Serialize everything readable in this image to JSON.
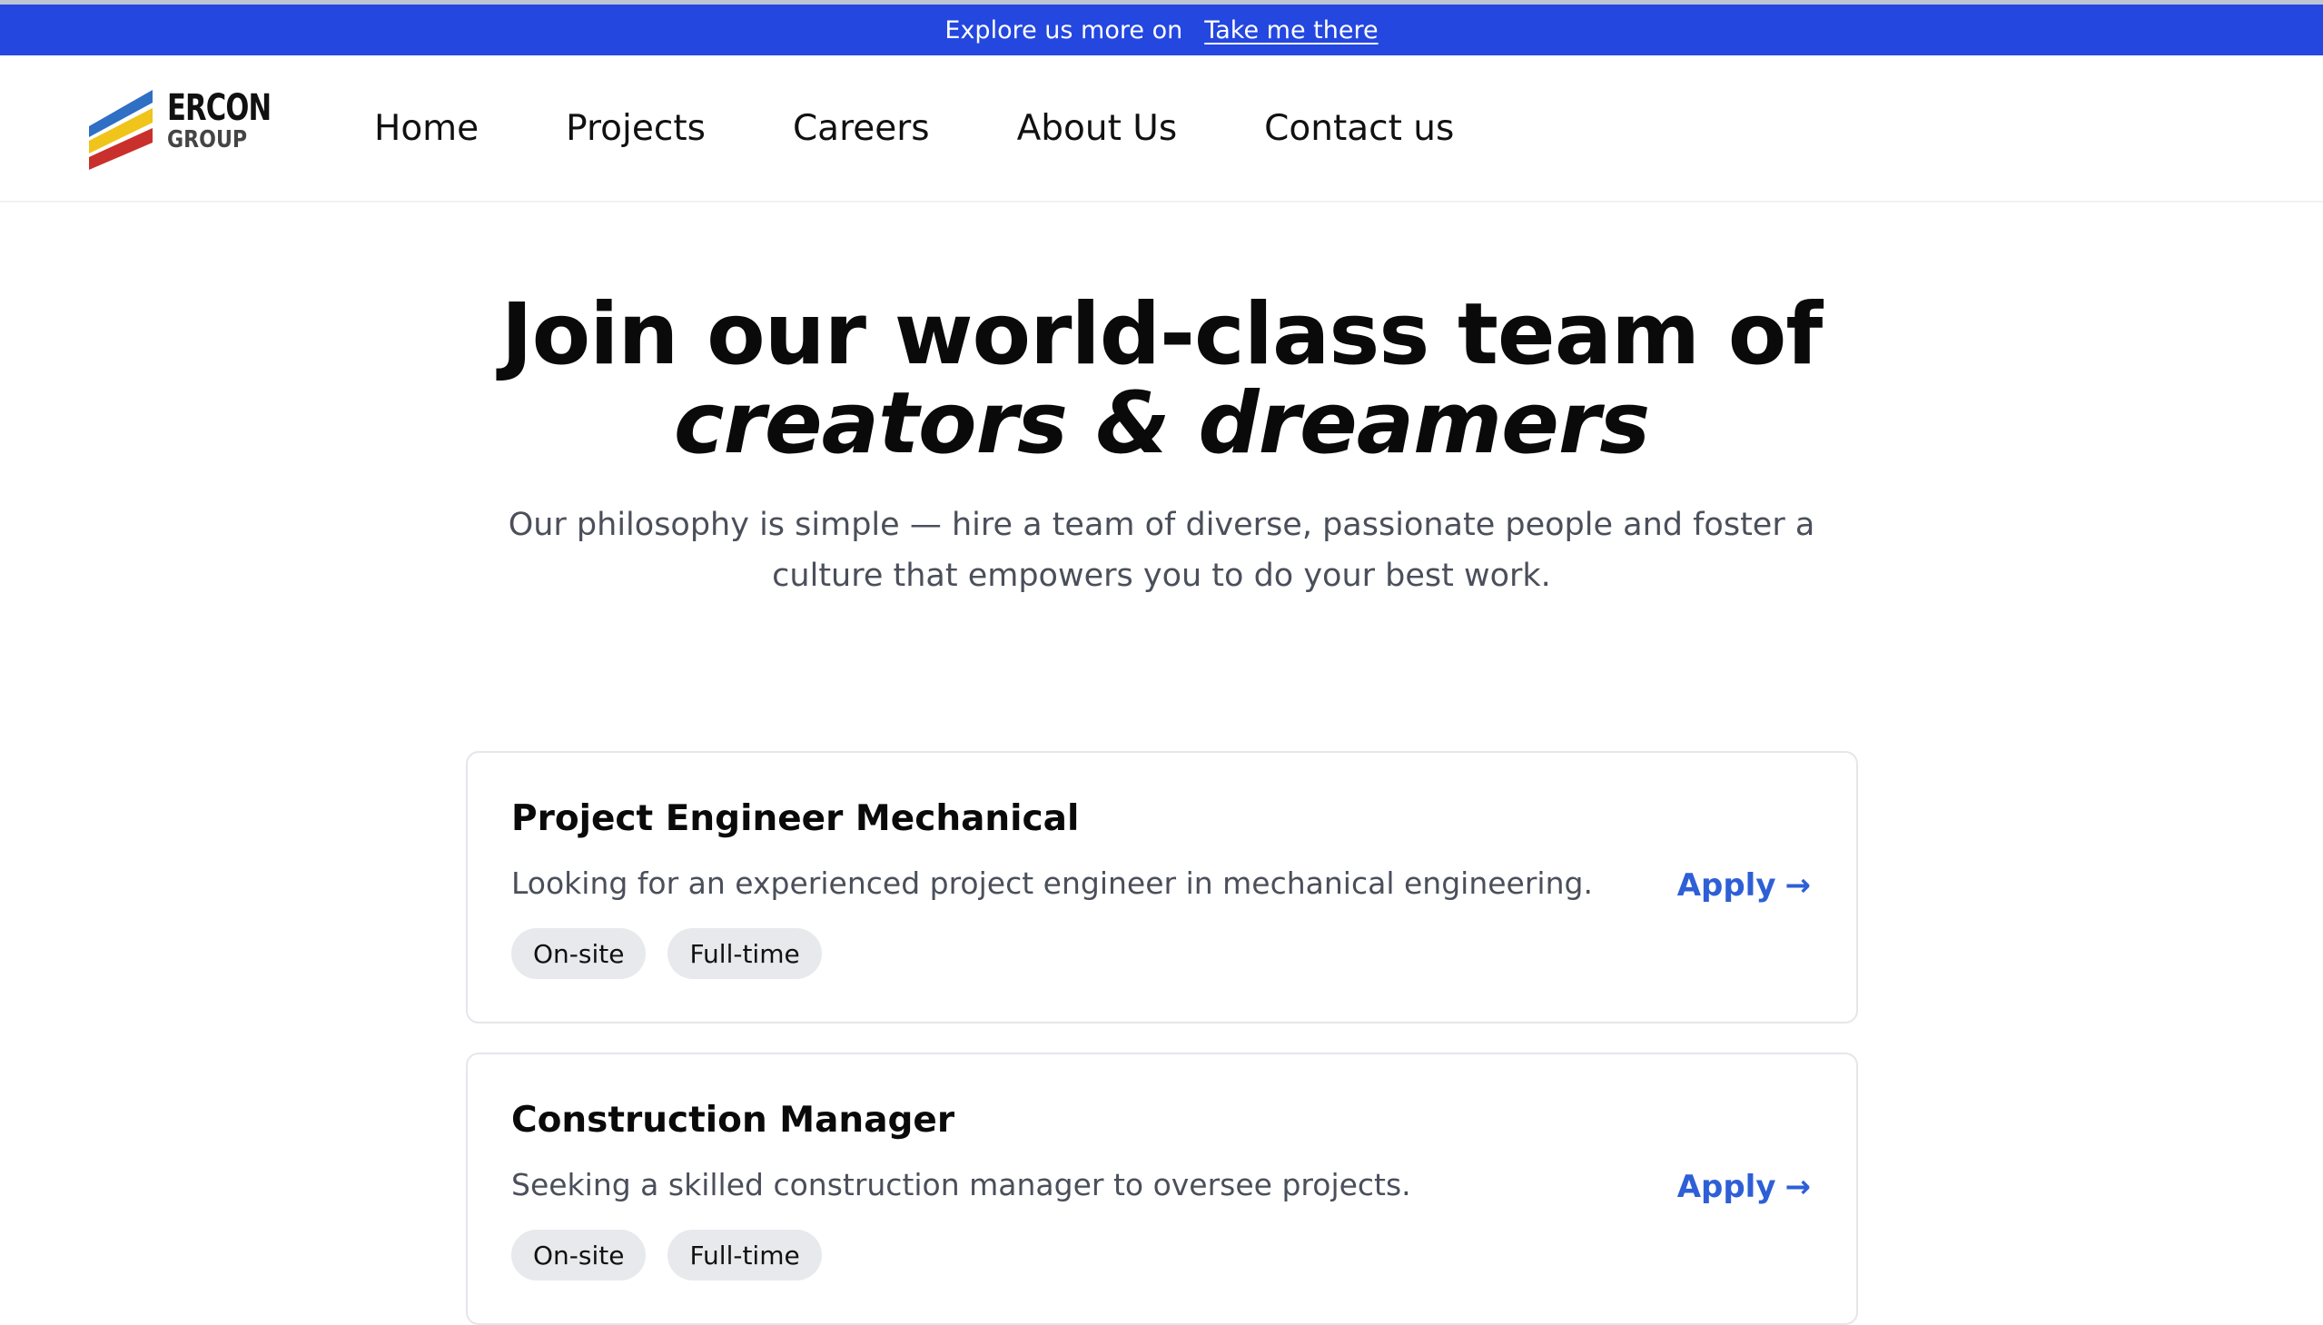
{
  "colors": {
    "announce_bg": "#2447e0",
    "accent_link": "#2e5fd6",
    "tag_bg": "#e8e9ec",
    "body_text": "#4a4f5a"
  },
  "announcement": {
    "text": "Explore us more on",
    "link": "Take me there"
  },
  "logo": {
    "brand": "ERCON",
    "sub": "GROUP"
  },
  "nav": {
    "items": [
      {
        "label": "Home"
      },
      {
        "label": "Projects"
      },
      {
        "label": "Careers"
      },
      {
        "label": "About Us"
      },
      {
        "label": "Contact us"
      }
    ]
  },
  "hero": {
    "title_line1": "Join our world-class team of",
    "title_line2": "creators & dreamers",
    "subtitle": "Our philosophy is simple — hire a team of diverse, passionate people and foster a culture that empowers you to do your best work."
  },
  "jobs": [
    {
      "title": "Project Engineer Mechanical",
      "description": "Looking for an experienced project engineer in mechanical engineering.",
      "tags": [
        "On-site",
        "Full-time"
      ],
      "apply_label": "Apply",
      "apply_icon": "arrow-right-icon"
    },
    {
      "title": "Construction Manager",
      "description": "Seeking a skilled construction manager to oversee projects.",
      "tags": [
        "On-site",
        "Full-time"
      ],
      "apply_label": "Apply",
      "apply_icon": "arrow-right-icon"
    }
  ]
}
